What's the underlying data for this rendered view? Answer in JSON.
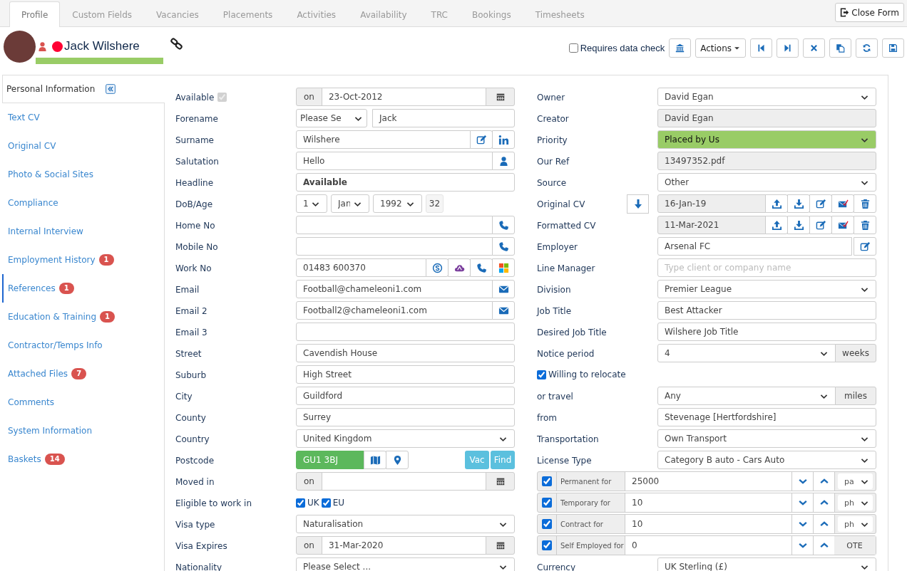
{
  "tabs": [
    {
      "label": "Profile",
      "selected": true
    },
    {
      "label": "Custom Fields",
      "selected": false
    },
    {
      "label": "Vacancies",
      "selected": false
    },
    {
      "label": "Placements",
      "selected": false
    },
    {
      "label": "Activities",
      "selected": false
    },
    {
      "label": "Availability",
      "selected": false
    },
    {
      "label": "TRC",
      "selected": false
    },
    {
      "label": "Bookings",
      "selected": false
    },
    {
      "label": "Timesheets",
      "selected": false
    }
  ],
  "close_button": "Close Form",
  "person": {
    "name": "Jack Wilshere",
    "color": "#ff0033"
  },
  "data_check": {
    "label": "Requires data check",
    "checked": false
  },
  "actions_button": "Actions",
  "sidebar": {
    "items": [
      {
        "label": "Personal Information",
        "selected": true,
        "highlighted": false
      },
      {
        "label": "Text CV",
        "selected": false,
        "highlighted": false
      },
      {
        "label": "Original CV",
        "selected": false,
        "highlighted": false
      },
      {
        "label": "Photo & Social Sites",
        "selected": false,
        "highlighted": false
      },
      {
        "label": "Compliance",
        "selected": false,
        "highlighted": false
      },
      {
        "label": "Internal Interview",
        "selected": false,
        "highlighted": false
      },
      {
        "label": "Employment History",
        "badge": "1",
        "selected": false,
        "highlighted": false
      },
      {
        "label": "References",
        "badge": "1",
        "selected": false,
        "highlighted": true
      },
      {
        "label": "Education & Training",
        "badge": "1",
        "selected": false,
        "highlighted": false
      },
      {
        "label": "Contractor/Temps Info",
        "selected": false,
        "highlighted": false
      },
      {
        "label": "Attached Files",
        "badge": "7",
        "selected": false,
        "highlighted": false
      },
      {
        "label": "Comments",
        "selected": false,
        "highlighted": false
      },
      {
        "label": "System Information",
        "selected": false,
        "highlighted": false
      },
      {
        "label": "Baskets",
        "badge": "14",
        "selected": false,
        "highlighted": false
      }
    ]
  },
  "left_fields": [
    {
      "label": "Available",
      "kind": "date",
      "check": {
        "checked": true,
        "disabled": true
      },
      "prefix": "on",
      "value": "23-Oct-2012"
    },
    {
      "label": "Forename",
      "kind": "title_name",
      "title": "Please Se",
      "value": "Jack"
    },
    {
      "label": "Surname",
      "kind": "text",
      "value": "Wilshere",
      "addons": [
        {
          "kind": "edit"
        },
        {
          "kind": "linkedin"
        }
      ]
    },
    {
      "label": "Salutation",
      "kind": "text",
      "value": "Hello",
      "addons": [
        {
          "kind": "person"
        }
      ]
    },
    {
      "label": "Headline",
      "kind": "text",
      "value": "Available",
      "bold": true
    },
    {
      "label": "DoB/Age",
      "kind": "dob",
      "day": "1",
      "month": "Jan",
      "year": "1992",
      "age": "32"
    },
    {
      "label": "Home No",
      "kind": "text",
      "addons": [
        {
          "kind": "phone"
        }
      ]
    },
    {
      "label": "Mobile No",
      "kind": "text",
      "addons": [
        {
          "kind": "phone"
        }
      ]
    },
    {
      "label": "Work No",
      "kind": "text",
      "value": "01483 600370",
      "addons": [
        {
          "kind": "skype"
        },
        {
          "kind": "cloud"
        },
        {
          "kind": "phone"
        },
        {
          "kind": "windows"
        }
      ]
    },
    {
      "label": "Email",
      "kind": "text",
      "value": "Football@chameleoni1.com",
      "addons": [
        {
          "kind": "mail"
        }
      ]
    },
    {
      "label": "Email 2",
      "kind": "text",
      "value": "Football2@chameleoni1.com",
      "addons": [
        {
          "kind": "mail"
        }
      ]
    },
    {
      "label": "Email 3",
      "kind": "text"
    },
    {
      "label": "Street",
      "kind": "text",
      "value": "Cavendish House"
    },
    {
      "label": "Suburb",
      "kind": "text",
      "value": "High Street"
    },
    {
      "label": "City",
      "kind": "text",
      "value": "Guildford"
    },
    {
      "label": "County",
      "kind": "text",
      "value": "Surrey"
    },
    {
      "label": "Country",
      "kind": "select",
      "value": "United Kingdom"
    },
    {
      "label": "Postcode",
      "kind": "postcode",
      "value": "GU1 3BJ",
      "buttons": [
        "Vac",
        "Find"
      ]
    },
    {
      "label": "Moved in",
      "kind": "date",
      "prefix": "on"
    },
    {
      "label": "Eligible to work in",
      "kind": "checks",
      "options": [
        {
          "label": "UK",
          "checked": true
        },
        {
          "label": "EU",
          "checked": true
        }
      ]
    },
    {
      "label": "Visa type",
      "kind": "select",
      "value": "Naturalisation"
    },
    {
      "label": "Visa Expires",
      "kind": "date",
      "prefix": "on",
      "value": "31-Mar-2020"
    },
    {
      "label": "Nationality",
      "kind": "select",
      "value": "Please Select ..."
    }
  ],
  "right_fields": [
    {
      "label": "Owner",
      "kind": "select",
      "value": "David Egan"
    },
    {
      "label": "Creator",
      "kind": "readonly",
      "value": "David Egan"
    },
    {
      "label": "Priority",
      "kind": "select",
      "value": "Placed by Us",
      "color": "#99cc66"
    },
    {
      "label": "Our Ref",
      "kind": "readonly",
      "value": "13497352.pdf"
    },
    {
      "label": "Source",
      "kind": "select",
      "value": "Other"
    },
    {
      "label": "Original CV",
      "kind": "file",
      "value": "16-Jan-19",
      "label_action": true
    },
    {
      "label": "Formatted CV",
      "kind": "file",
      "value": "11-Mar-2021",
      "label_action": false
    },
    {
      "label": "Employer",
      "kind": "text",
      "value": "Arsenal FC",
      "addons": [
        {
          "kind": "edit"
        }
      ],
      "detached": true
    },
    {
      "label": "Line Manager",
      "kind": "text",
      "placeholder": "Type client or company name"
    },
    {
      "label": "Division",
      "kind": "select",
      "value": "Premier League"
    },
    {
      "label": "Job Title",
      "kind": "text",
      "value": "Best Attacker"
    },
    {
      "label": "Desired Job Title",
      "kind": "text",
      "value": "Wilshere Job Title"
    },
    {
      "label": "Notice period",
      "kind": "select",
      "value": "4",
      "suffix": "weeks"
    },
    {
      "label": "Willing to relocate",
      "kind": "check",
      "checked": true
    },
    {
      "label": "or travel",
      "kind": "select",
      "value": "Any",
      "suffix": "miles"
    },
    {
      "label": "from",
      "kind": "text",
      "value": "Stevenage [Hertfordshire]"
    },
    {
      "label": "Transportation",
      "kind": "select",
      "value": "Own Transport"
    },
    {
      "label": "License Type",
      "kind": "select",
      "value": "Category B auto - Cars Auto"
    },
    {
      "label": "Permanent for",
      "kind": "rate",
      "checked": true,
      "value": "25000",
      "unit": {
        "kind": "select",
        "value": "pa"
      }
    },
    {
      "label": "Temporary for",
      "kind": "rate",
      "checked": true,
      "value": "10",
      "unit": {
        "kind": "select",
        "value": "ph"
      }
    },
    {
      "label": "Contract for",
      "kind": "rate",
      "checked": true,
      "value": "10",
      "unit": {
        "kind": "select",
        "value": "ph"
      }
    },
    {
      "label": "Self Employed for",
      "kind": "rate",
      "checked": true,
      "value": "0",
      "unit": {
        "kind": "button",
        "value": "OTE"
      }
    },
    {
      "label": "Currency",
      "kind": "select",
      "value": "UK Sterling (£)"
    }
  ]
}
